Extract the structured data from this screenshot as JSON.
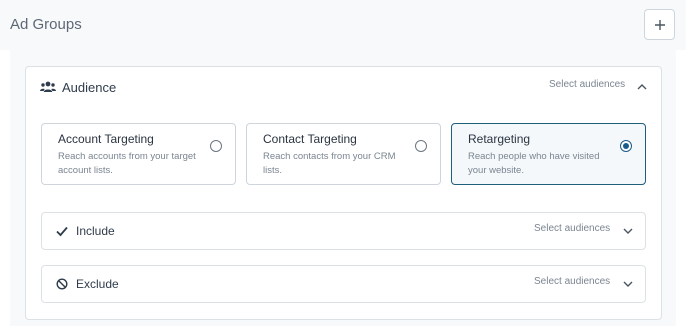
{
  "header": {
    "title": "Ad Groups",
    "add_icon": "plus-icon"
  },
  "audience": {
    "icon": "users-icon",
    "title": "Audience",
    "hint": "Select audiences",
    "chevron_icon": "chevron-up-icon",
    "options": [
      {
        "title": "Account Targeting",
        "description": "Reach accounts from your target account lists.",
        "selected": false
      },
      {
        "title": "Contact Targeting",
        "description": "Reach contacts from your CRM lists.",
        "selected": false
      },
      {
        "title": "Retargeting",
        "description": "Reach people who have visited your website.",
        "selected": true
      }
    ],
    "include": {
      "icon": "check-icon",
      "label": "Include",
      "hint": "Select audiences",
      "chevron_icon": "chevron-down-icon"
    },
    "exclude": {
      "icon": "ban-icon",
      "label": "Exclude",
      "hint": "Select audiences",
      "chevron_icon": "chevron-down-icon"
    }
  },
  "colors": {
    "selected_border": "#1f5f7a",
    "radio_checked": "#1a5b8a",
    "panel_border": "#dce1e6",
    "header_bg": "#f8f9fa"
  }
}
